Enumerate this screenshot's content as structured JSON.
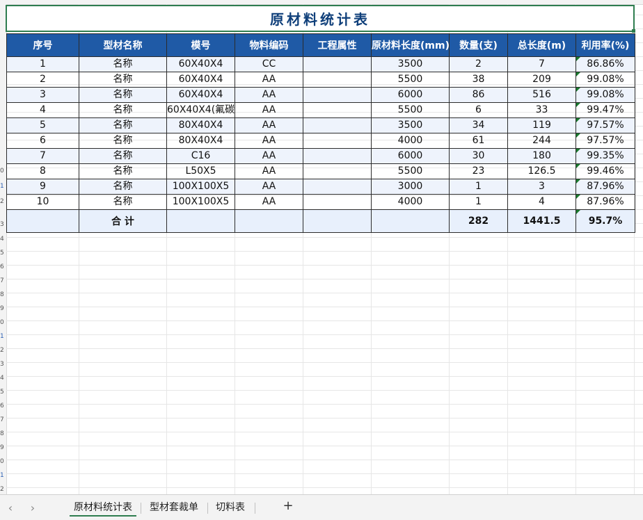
{
  "title": "原材料统计表",
  "headers": [
    "序号",
    "型材名称",
    "模号",
    "物料编码",
    "工程属性",
    "原材料长度(mm)",
    "数量(支)",
    "总长度(m)",
    "利用率(%)"
  ],
  "rows": [
    {
      "no": "1",
      "name": "名称",
      "model": "60X40X4",
      "code": "CC",
      "prop": "",
      "len": "3500",
      "qty": "2",
      "total": "7",
      "rate": "86.86%"
    },
    {
      "no": "2",
      "name": "名称",
      "model": "60X40X4",
      "code": "AA",
      "prop": "",
      "len": "5500",
      "qty": "38",
      "total": "209",
      "rate": "99.08%"
    },
    {
      "no": "3",
      "name": "名称",
      "model": "60X40X4",
      "code": "AA",
      "prop": "",
      "len": "6000",
      "qty": "86",
      "total": "516",
      "rate": "99.08%"
    },
    {
      "no": "4",
      "name": "名称",
      "model": "60X40X4(氟碳",
      "code": "AA",
      "prop": "",
      "len": "5500",
      "qty": "6",
      "total": "33",
      "rate": "99.47%"
    },
    {
      "no": "5",
      "name": "名称",
      "model": "80X40X4",
      "code": "AA",
      "prop": "",
      "len": "3500",
      "qty": "34",
      "total": "119",
      "rate": "97.57%"
    },
    {
      "no": "6",
      "name": "名称",
      "model": "80X40X4",
      "code": "AA",
      "prop": "",
      "len": "4000",
      "qty": "61",
      "total": "244",
      "rate": "97.57%"
    },
    {
      "no": "7",
      "name": "名称",
      "model": "C16",
      "code": "AA",
      "prop": "",
      "len": "6000",
      "qty": "30",
      "total": "180",
      "rate": "99.35%"
    },
    {
      "no": "8",
      "name": "名称",
      "model": "L50X5",
      "code": "AA",
      "prop": "",
      "len": "5500",
      "qty": "23",
      "total": "126.5",
      "rate": "99.46%"
    },
    {
      "no": "9",
      "name": "名称",
      "model": "100X100X5",
      "code": "AA",
      "prop": "",
      "len": "3000",
      "qty": "1",
      "total": "3",
      "rate": "87.96%"
    },
    {
      "no": "10",
      "name": "名称",
      "model": "100X100X5",
      "code": "AA",
      "prop": "",
      "len": "4000",
      "qty": "1",
      "total": "4",
      "rate": "87.96%"
    }
  ],
  "total_row": {
    "label": "合 计",
    "qty": "282",
    "total": "1441.5",
    "rate": "95.7%"
  },
  "tabs": {
    "prev": "‹",
    "next": "›",
    "sheet1": "原材料统计表",
    "sheet2": "型材套裁单",
    "sheet3": "切料表",
    "add": "+"
  },
  "colors": {
    "header_bg": "#1f5aa6",
    "title_text": "#0f3f7a",
    "accent_green": "#2e7d4f",
    "alt_row": "#eef3fc"
  }
}
